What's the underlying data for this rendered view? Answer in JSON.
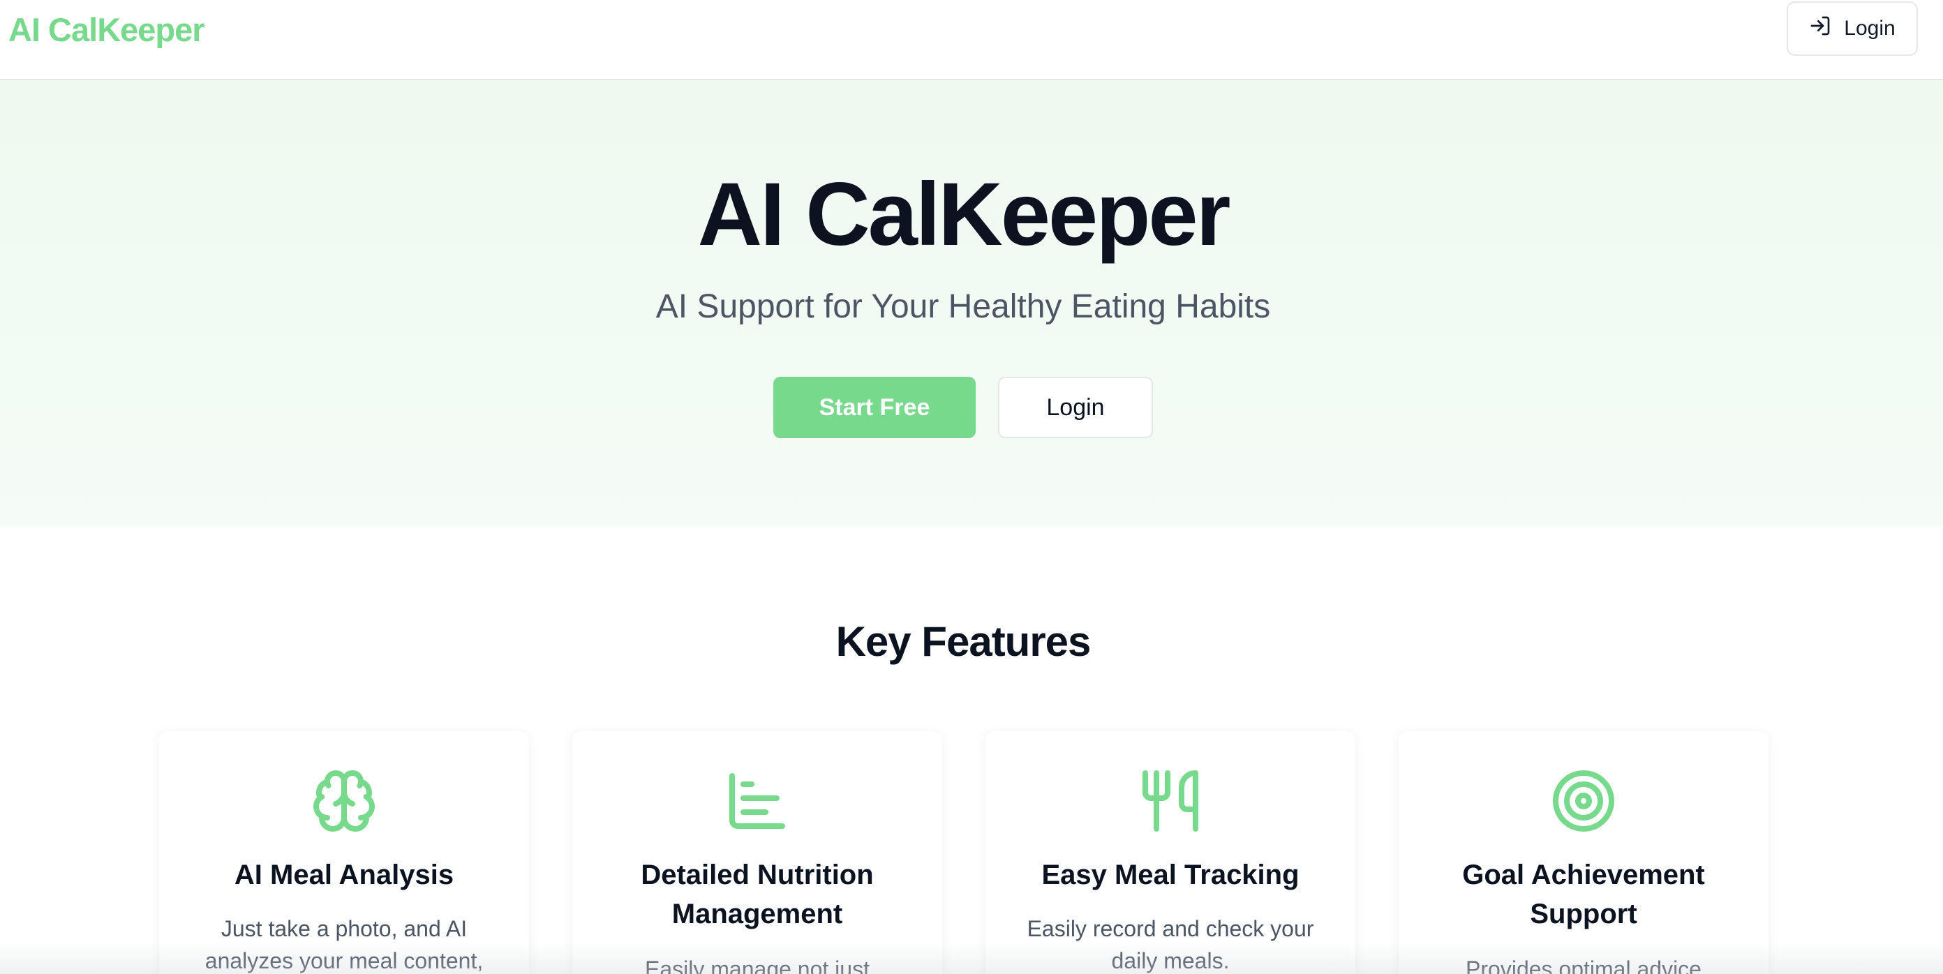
{
  "header": {
    "brand": "AI CalKeeper",
    "login_label": "Login"
  },
  "hero": {
    "title": "AI CalKeeper",
    "subtitle": "AI Support for Your Healthy Eating Habits",
    "start_label": "Start Free",
    "login_label": "Login"
  },
  "features": {
    "title": "Key Features",
    "items": [
      {
        "icon": "brain-icon",
        "title": "AI Meal Analysis",
        "description": "Just take a photo, and AI analyzes your meal content,"
      },
      {
        "icon": "bar-chart-icon",
        "title": "Detailed Nutrition Management",
        "description": "Easily manage not just"
      },
      {
        "icon": "utensils-icon",
        "title": "Easy Meal Tracking",
        "description": "Easily record and check your daily meals."
      },
      {
        "icon": "target-icon",
        "title": "Goal Achievement Support",
        "description": "Provides optimal advice"
      }
    ]
  },
  "colors": {
    "accent": "#77d98c",
    "hero_background": "#eef9f0",
    "heading": "#0b1220",
    "body_text": "#4b5563"
  }
}
